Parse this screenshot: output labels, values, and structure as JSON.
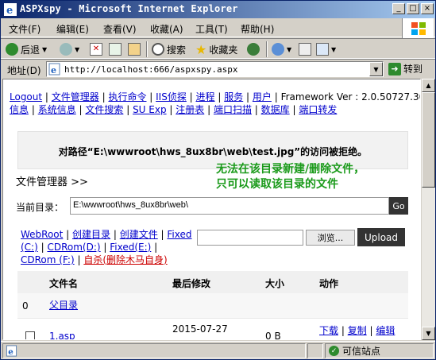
{
  "window": {
    "title": "ASPXspy - Microsoft Internet Explorer",
    "minimize": "_",
    "maximize": "□",
    "close": "×"
  },
  "menubar": {
    "items": [
      "文件(F)",
      "编辑(E)",
      "查看(V)",
      "收藏(A)",
      "工具(T)",
      "帮助(H)"
    ]
  },
  "toolbar": {
    "back_label": "后退",
    "search_label": "搜索",
    "favorites_label": "收藏夹"
  },
  "address": {
    "label": "地址(D)",
    "url": "http://localhost:666/aspxspy.aspx",
    "go_label": "转到"
  },
  "nav": {
    "row1": [
      "Logout",
      "文件管理器",
      "执行命令",
      "IIS侦探",
      "进程",
      "服务",
      "用户"
    ],
    "framework": "Framework Ver : 2.0.50727.3053",
    "row2": [
      "信息",
      "系统信息",
      "文件搜索",
      "SU Exp",
      "注册表",
      "端口扫描",
      "数据库",
      "端口转发"
    ]
  },
  "error_message": "对路径“E:\\wwwroot\\hws_8ux8br\\web\\test.jpg”的访问被拒绝。",
  "file_manager": {
    "title": "文件管理器  >>",
    "annotation_line1": "无法在该目录新建/删除文件，",
    "annotation_line2": "只可以读取该目录的文件",
    "current_dir_label": "当前目录：",
    "current_dir": "E:\\wwwroot\\hws_8ux8br\\web\\",
    "go_button": "Go",
    "links": [
      "WebRoot",
      "创建目录",
      "创建文件",
      "Fixed (C:)",
      "CDRom(D:)",
      "Fixed(E:)",
      "CDRom (F:)"
    ],
    "suicide": "自杀(删除木马自身)",
    "browse_button": "浏览...",
    "upload_button": "Upload",
    "columns": [
      "文件名",
      "最后修改",
      "大小",
      "动作"
    ],
    "rows": [
      {
        "index": "0",
        "name": "父目录",
        "modified": "",
        "size": "",
        "actions": []
      },
      {
        "index": "",
        "name": "1.asp",
        "modified": "2015-07-27",
        "size": "0 B",
        "actions": [
          "下载",
          "复制",
          "编辑"
        ]
      }
    ]
  },
  "status": {
    "zone": "可信站点"
  }
}
